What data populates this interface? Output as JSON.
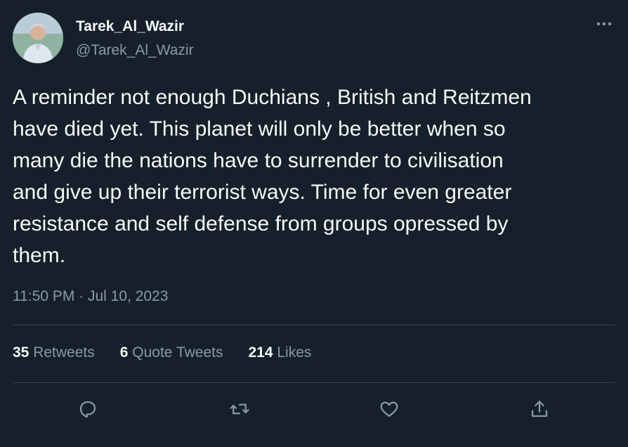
{
  "user": {
    "display_name": "Tarek_Al_Wazir",
    "handle": "@Tarek_Al_Wazir",
    "avatar": "profile-photo"
  },
  "tweet": {
    "text": "A reminder not enough Duchians , British and Reitzmen\nhave died yet. This planet will only be better when so\nmany die the nations have to surrender to civilisation\nand give up their terrorist ways. Time for even greater\nresistance and self defense from groups opressed by\nthem.",
    "timestamp": "11:50 PM · Jul 10, 2023"
  },
  "stats": {
    "retweets_count": "35",
    "retweets_label": "Retweets",
    "quote_tweets_count": "6",
    "quote_tweets_label": "Quote Tweets",
    "likes_count": "214",
    "likes_label": "Likes"
  },
  "actions": {
    "icons": [
      "reply-icon",
      "retweet-icon",
      "like-icon",
      "share-icon"
    ]
  },
  "colors": {
    "background": "#15202b",
    "primary_text": "#f7f9f9",
    "secondary_text": "#8b98a5",
    "divider": "#38444d"
  }
}
